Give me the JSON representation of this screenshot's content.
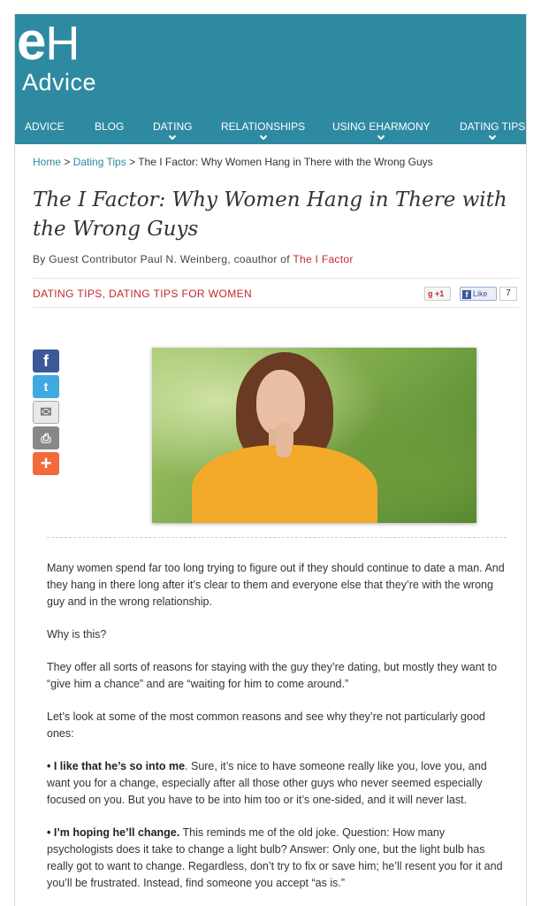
{
  "logo": {
    "text_bold": "e",
    "text_light": "H",
    "advice": "Advice"
  },
  "nav": [
    {
      "label": "ADVICE",
      "dropdown": false
    },
    {
      "label": "BLOG",
      "dropdown": false
    },
    {
      "label": "DATING",
      "dropdown": true
    },
    {
      "label": "RELATIONSHIPS",
      "dropdown": true
    },
    {
      "label": "USING EHARMONY",
      "dropdown": true
    },
    {
      "label": "DATING TIPS",
      "dropdown": true
    }
  ],
  "breadcrumb": {
    "home": "Home",
    "sep1": " > ",
    "section": "Dating Tips",
    "sep2": " > ",
    "current": "The I Factor: Why Women Hang in There with the Wrong Guys"
  },
  "article": {
    "title": "The I Factor: Why Women Hang in There with the Wrong Guys",
    "byline_prefix": "By Guest Contributor Paul N. Weinberg, coauthor of ",
    "byline_book": "The I Factor",
    "categories": "DATING TIPS, DATING TIPS FOR WOMEN",
    "gplus_label": "+1",
    "fb_like_label": "Like",
    "fb_count": "7",
    "paragraphs": [
      "Many women spend far too long trying to figure out if they should continue to date a man. And they hang in there long after it’s clear to them and everyone else that they’re with the wrong guy and in the wrong relationship.",
      "Why is this?",
      "They offer all sorts of reasons for staying with the guy they’re dating, but mostly they want to “give him a chance” and are “waiting for him to come around.”",
      "Let’s look at some of the most common reasons and see why they’re not particularly good ones:"
    ],
    "bullets": [
      {
        "lead": "• I like that he’s so into me",
        "text": ". Sure, it’s nice to have someone really like you, love you, and want you for a change, especially after all those other guys who never seemed especially focused on you. But you have to be into him too or it’s one-sided, and it will never last."
      },
      {
        "lead": "• I’m hoping he’ll change.",
        "text": " This reminds me of the old joke. Question: How many psychologists does it take to change a light bulb? Answer: Only one, but the light bulb has really got to want to change. Regardless, don’t try to fix or save him; he’ll resent you for it and you’ll be frustrated. Instead, find someone you accept “as is.”"
      }
    ]
  },
  "social": [
    "facebook-icon",
    "twitter-icon",
    "email-icon",
    "print-icon",
    "share-more-icon"
  ],
  "colors": {
    "header": "#2e8aa1",
    "link": "#2e8aa1",
    "accent_red": "#c2272d",
    "nav_text": "#ffffff"
  }
}
